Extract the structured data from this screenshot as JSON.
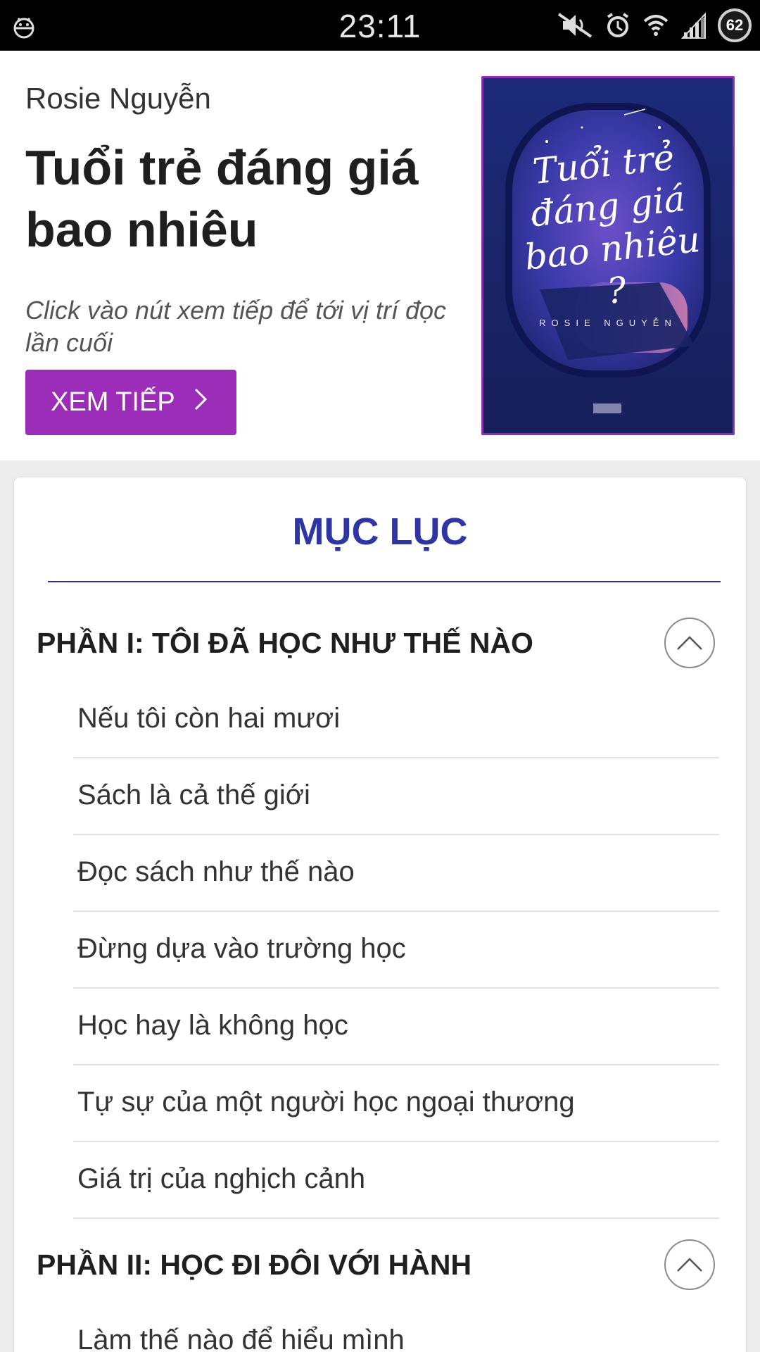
{
  "status_bar": {
    "time": "23:11",
    "battery": "62",
    "icons": [
      "bug-icon",
      "mute-icon",
      "alarm-icon",
      "wifi-icon",
      "signal-icon",
      "battery-icon"
    ]
  },
  "book": {
    "author": "Rosie Nguyễn",
    "title": "Tuổi trẻ đáng giá bao nhiêu",
    "hint": "Click vào nút xem tiếp để tới vị trí đọc lần cuối",
    "continue_label": "XEM TIẾP",
    "cover": {
      "title": "Tuổi trẻ đáng giá bao nhiêu ?",
      "author": "ROSIE NGUYỄN"
    }
  },
  "toc": {
    "heading": "MỤC LỤC",
    "parts": [
      {
        "title": "PHẦN I: TÔI ĐÃ HỌC NHƯ THẾ NÀO",
        "chapters": [
          "Nếu tôi còn hai mươi",
          "Sách là cả thế giới",
          "Đọc sách như thế nào",
          "Đừng dựa vào trường học",
          "Học hay là không học",
          "Tự sự của một người học ngoại thương",
          "Giá trị của nghịch cảnh"
        ]
      },
      {
        "title": "PHẦN II: HỌC ĐI ĐÔI VỚI HÀNH",
        "chapters": [
          "Làm thế nào để hiểu mình"
        ]
      }
    ]
  },
  "colors": {
    "accent": "#9b2db9",
    "heading": "#2e36a3",
    "rule": "#2e3192"
  }
}
